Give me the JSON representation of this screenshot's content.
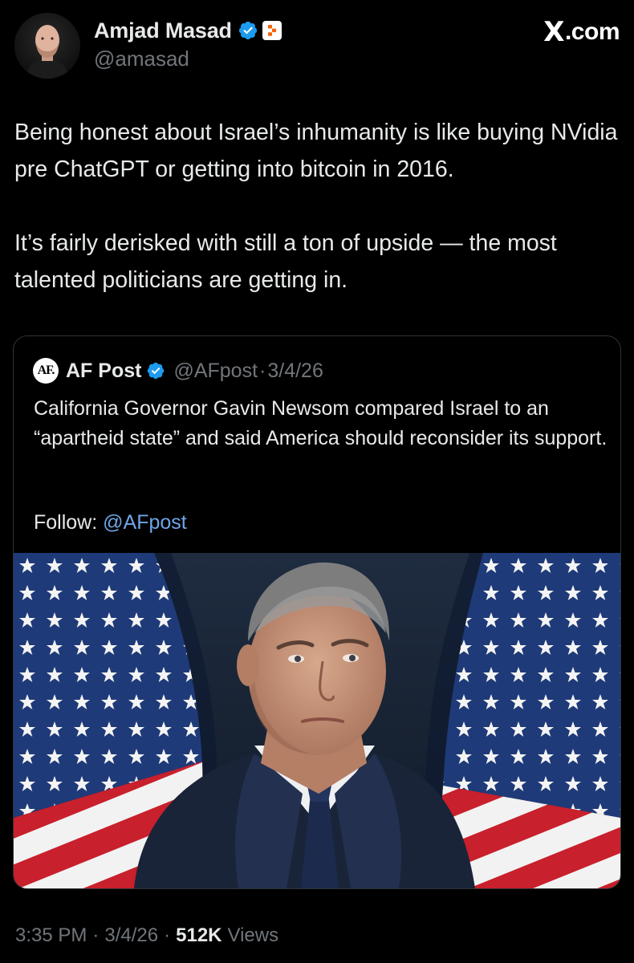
{
  "author": {
    "name": "Amjad Masad",
    "handle": "@amasad"
  },
  "site_label": {
    "mark": "X",
    "text": ".com"
  },
  "tweet": {
    "paragraphs": [
      "Being honest about Israel’s inhumanity is like buying NVidia pre ChatGPT or getting into bitcoin in 2016.",
      "It’s fairly derisked with still a ton of upside — the most talented politicians are getting in."
    ]
  },
  "quote": {
    "avatar_text": "AF.",
    "name": "AF Post",
    "handle": "@AFpost",
    "separator": "·",
    "date": "3/4/26",
    "body": "California Governor Gavin Newsom compared Israel to an “apartheid state” and said America should reconsider its support.",
    "follow_label": "Follow:",
    "follow_mention": "@AFpost"
  },
  "footer": {
    "time": "3:35 PM",
    "separator": "·",
    "date": "3/4/26",
    "views_count": "512K",
    "views_label": "Views"
  },
  "colors": {
    "background": "#000000",
    "text_primary": "#e7e9ea",
    "text_secondary": "#71767b",
    "verified_blue": "#1d9bf0",
    "link_blue": "#6ea6e8",
    "border": "#2f3336"
  },
  "icons": {
    "verified": "verified-badge-icon",
    "affiliation": "replit-logo-icon",
    "site": "x-logo-icon"
  }
}
